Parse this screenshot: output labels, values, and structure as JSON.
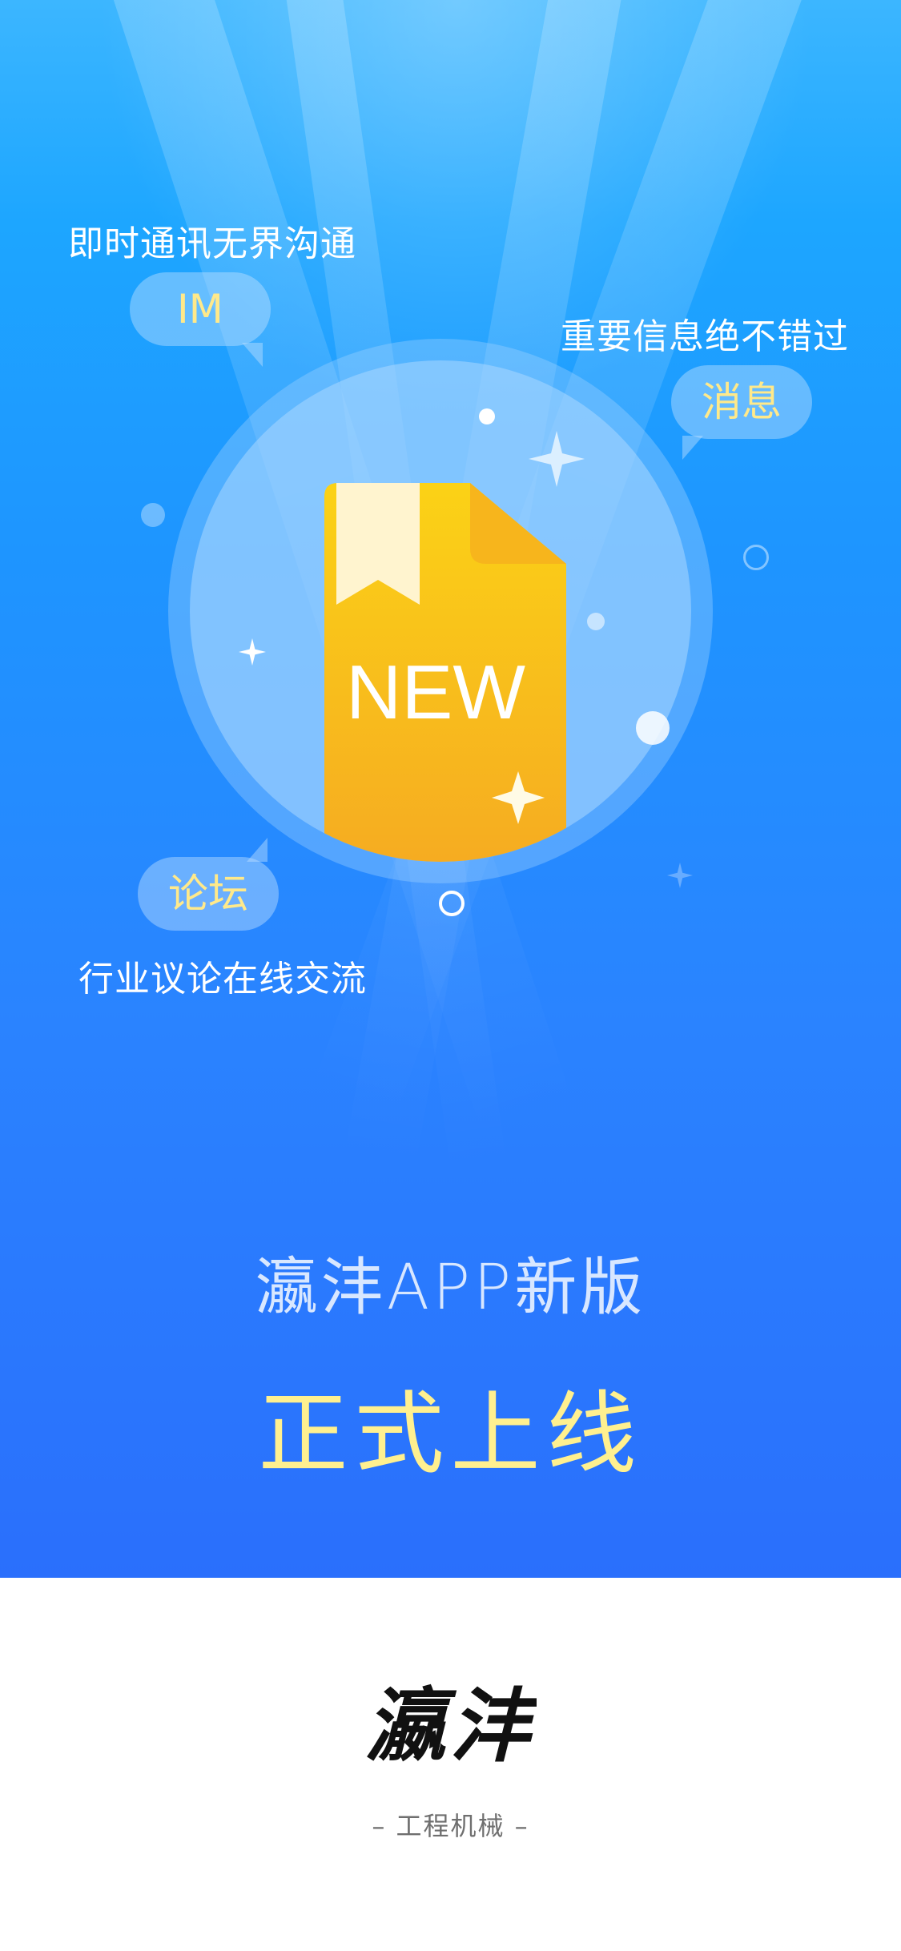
{
  "features": {
    "im": {
      "caption": "即时通讯无界沟通",
      "badge": "IM"
    },
    "message": {
      "caption": "重要信息绝不错过",
      "badge": "消息"
    },
    "forum": {
      "badge": "论坛",
      "caption": "行业议论在线交流"
    }
  },
  "illustration": {
    "doc_label": "NEW"
  },
  "release": {
    "title": "瀛沣APP新版",
    "subtitle": "正式上线"
  },
  "brand": {
    "logo_text": "瀛沣",
    "tagline": "– 工程机械 –"
  },
  "colors": {
    "bg_top": "#3cb6ff",
    "bg_bottom": "#2a6ffc",
    "accent_yellow": "#ffe98a",
    "doc_yellow": "#fbd216",
    "doc_orange": "#f5a623"
  }
}
